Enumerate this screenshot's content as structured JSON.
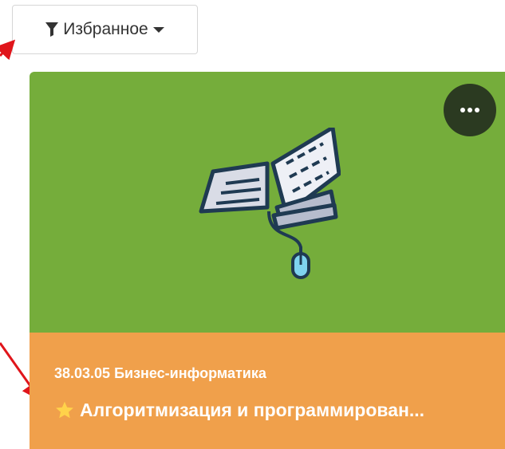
{
  "filter": {
    "label": "Избранное",
    "icon": "filter-icon",
    "dropdown_icon": "caret-down-icon"
  },
  "card": {
    "image_color": "#75ad3b",
    "footer_color": "#f0a04b",
    "menu_icon": "ellipsis-icon",
    "menu_color": "#2b3a21",
    "illustration_icon": "book-with-mouse-icon",
    "category": "38.03.05 Бизнес-информатика",
    "title": "Алгоритмизация и программирован...",
    "favorite_icon": "star-icon",
    "favorite_color": "#ffd24a"
  },
  "annotations": {
    "arrow_color": "#e0151b"
  }
}
